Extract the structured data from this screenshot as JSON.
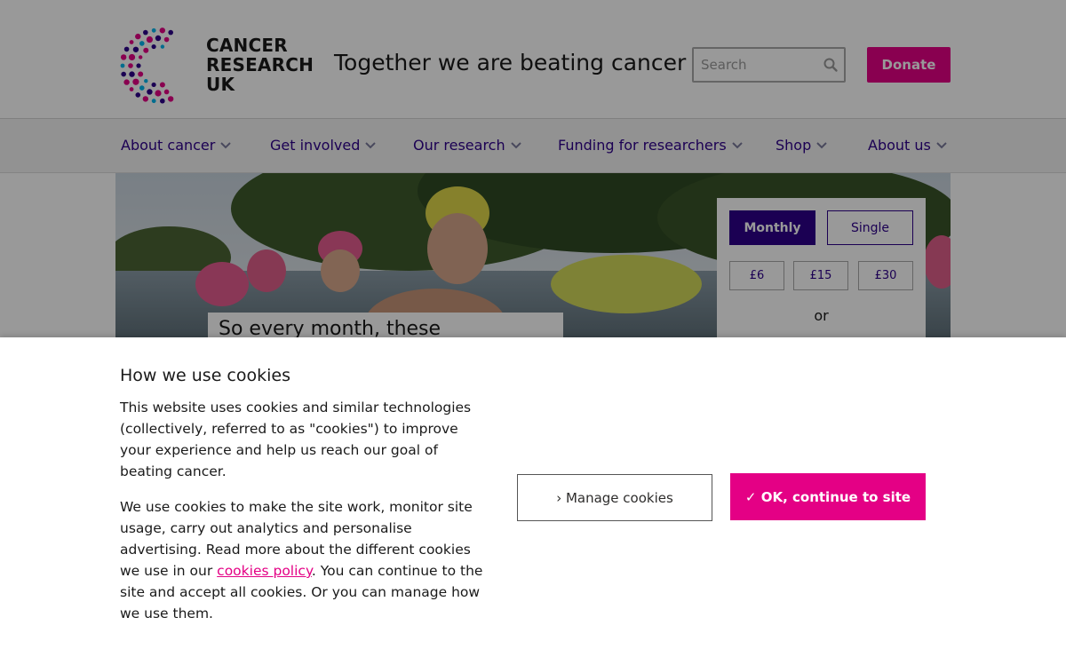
{
  "header": {
    "logo_lines": [
      "CANCER",
      "RESEARCH",
      "UK"
    ],
    "tagline": "Together we are beating cancer",
    "search_placeholder": "Search",
    "search_icon": "search-icon",
    "donate_label": "Donate",
    "brand_color": "#e40085",
    "nav_color": "#2e008b"
  },
  "nav": {
    "items": [
      {
        "label": "About cancer"
      },
      {
        "label": "Get involved"
      },
      {
        "label": "Our research"
      },
      {
        "label": "Funding for researchers"
      },
      {
        "label": "Shop"
      },
      {
        "label": "About us"
      }
    ],
    "chevron_icon": "chevron-down-icon"
  },
  "hero": {
    "caption": "So every month, these"
  },
  "donate_panel": {
    "frequency": [
      "Monthly",
      "Single"
    ],
    "selected_frequency": "Monthly",
    "amounts": [
      "£6",
      "£15",
      "£30"
    ],
    "or_label": "or"
  },
  "cookie_banner": {
    "title": "How we use cookies",
    "paragraph1": "This website uses cookies and similar technologies (collectively, referred to as \"cookies\") to improve your experience and help us reach our goal of beating cancer.",
    "paragraph2_before": "We use cookies to make the site work, monitor site usage, carry out analytics and personalise advertising. Read more about the different cookies we use in our ",
    "policy_link": "cookies policy",
    "paragraph2_after": ". You can continue to the site and accept all cookies. Or you can manage how we use them.",
    "manage_label": "› Manage cookies",
    "ok_label": "✓ OK, continue to site"
  }
}
